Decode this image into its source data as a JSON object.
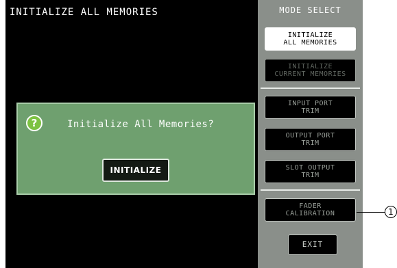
{
  "screen": {
    "title": "INITIALIZE ALL MEMORIES"
  },
  "dialog": {
    "icon": "question-mark-icon",
    "icon_glyph": "?",
    "message": "Initialize All Memories?",
    "initialize_label": "INITIALIZE"
  },
  "mode_panel": {
    "header": "MODE SELECT",
    "buttons": [
      {
        "label": "INITIALIZE\nALL MEMORIES",
        "state": "active"
      },
      {
        "label": "INITIALIZE\nCURRENT MEMORIES",
        "state": "faded"
      },
      {
        "label": "INPUT PORT\nTRIM",
        "state": "inactive"
      },
      {
        "label": "OUTPUT PORT\nTRIM",
        "state": "inactive"
      },
      {
        "label": "SLOT OUTPUT\nTRIM",
        "state": "inactive"
      },
      {
        "label": "FADER\nCALIBRATION",
        "state": "inactive"
      }
    ],
    "exit_label": "EXIT"
  },
  "callout": {
    "number": "1"
  },
  "colors": {
    "screen_bg": "#000000",
    "dialog_bg": "#6fa06f",
    "panel_bg": "#8a8f8a",
    "icon_green": "#7dc242"
  }
}
